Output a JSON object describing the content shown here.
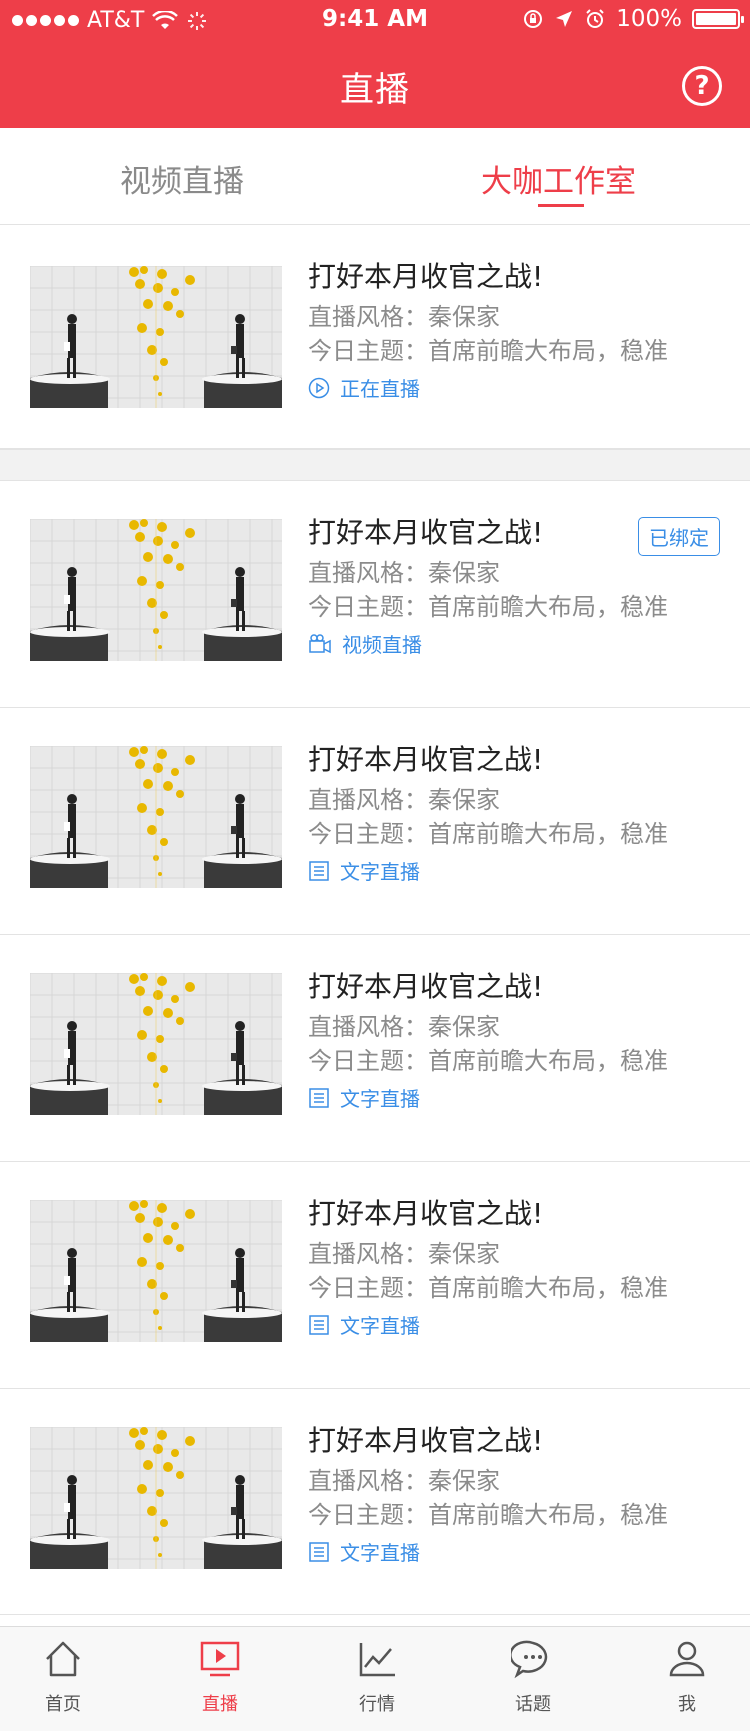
{
  "status_bar": {
    "carrier": "AT&T",
    "time": "9:41 AM",
    "battery": "100%"
  },
  "nav": {
    "title": "直播",
    "help_icon": "question-mark-icon"
  },
  "tabs": [
    {
      "label": "视频直播",
      "active": false
    },
    {
      "label": "大咖工作室",
      "active": true
    }
  ],
  "items": [
    {
      "title": "打好本月收官之战!",
      "style": "直播风格：秦保家",
      "topic": "今日主题：首席前瞻大布局，稳准",
      "status": "正在直播",
      "status_icon": "play-circle-icon",
      "badge": ""
    },
    {
      "title": "打好本月收官之战!",
      "style": "直播风格：秦保家",
      "topic": "今日主题：首席前瞻大布局，稳准",
      "status": "视频直播",
      "status_icon": "video-camera-icon",
      "badge": "已绑定"
    },
    {
      "title": "打好本月收官之战!",
      "style": "直播风格：秦保家",
      "topic": "今日主题：首席前瞻大布局，稳准",
      "status": "文字直播",
      "status_icon": "text-document-icon",
      "badge": ""
    },
    {
      "title": "打好本月收官之战!",
      "style": "直播风格：秦保家",
      "topic": "今日主题：首席前瞻大布局，稳准",
      "status": "文字直播",
      "status_icon": "text-document-icon",
      "badge": ""
    },
    {
      "title": "打好本月收官之战!",
      "style": "直播风格：秦保家",
      "topic": "今日主题：首席前瞻大布局，稳准",
      "status": "文字直播",
      "status_icon": "text-document-icon",
      "badge": ""
    },
    {
      "title": "打好本月收官之战!",
      "style": "直播风格：秦保家",
      "topic": "今日主题：首席前瞻大布局，稳准",
      "status": "文字直播",
      "status_icon": "text-document-icon",
      "badge": ""
    }
  ],
  "tabbar": [
    {
      "label": "首页",
      "icon": "home-icon",
      "active": false
    },
    {
      "label": "直播",
      "icon": "live-play-icon",
      "active": true
    },
    {
      "label": "行情",
      "icon": "market-chart-icon",
      "active": false
    },
    {
      "label": "话题",
      "icon": "chat-bubble-icon",
      "active": false
    },
    {
      "label": "我",
      "icon": "user-icon",
      "active": false
    }
  ],
  "colors": {
    "brand": "#ee3e49",
    "link": "#3a8ee6",
    "muted": "#8b8b8b"
  }
}
